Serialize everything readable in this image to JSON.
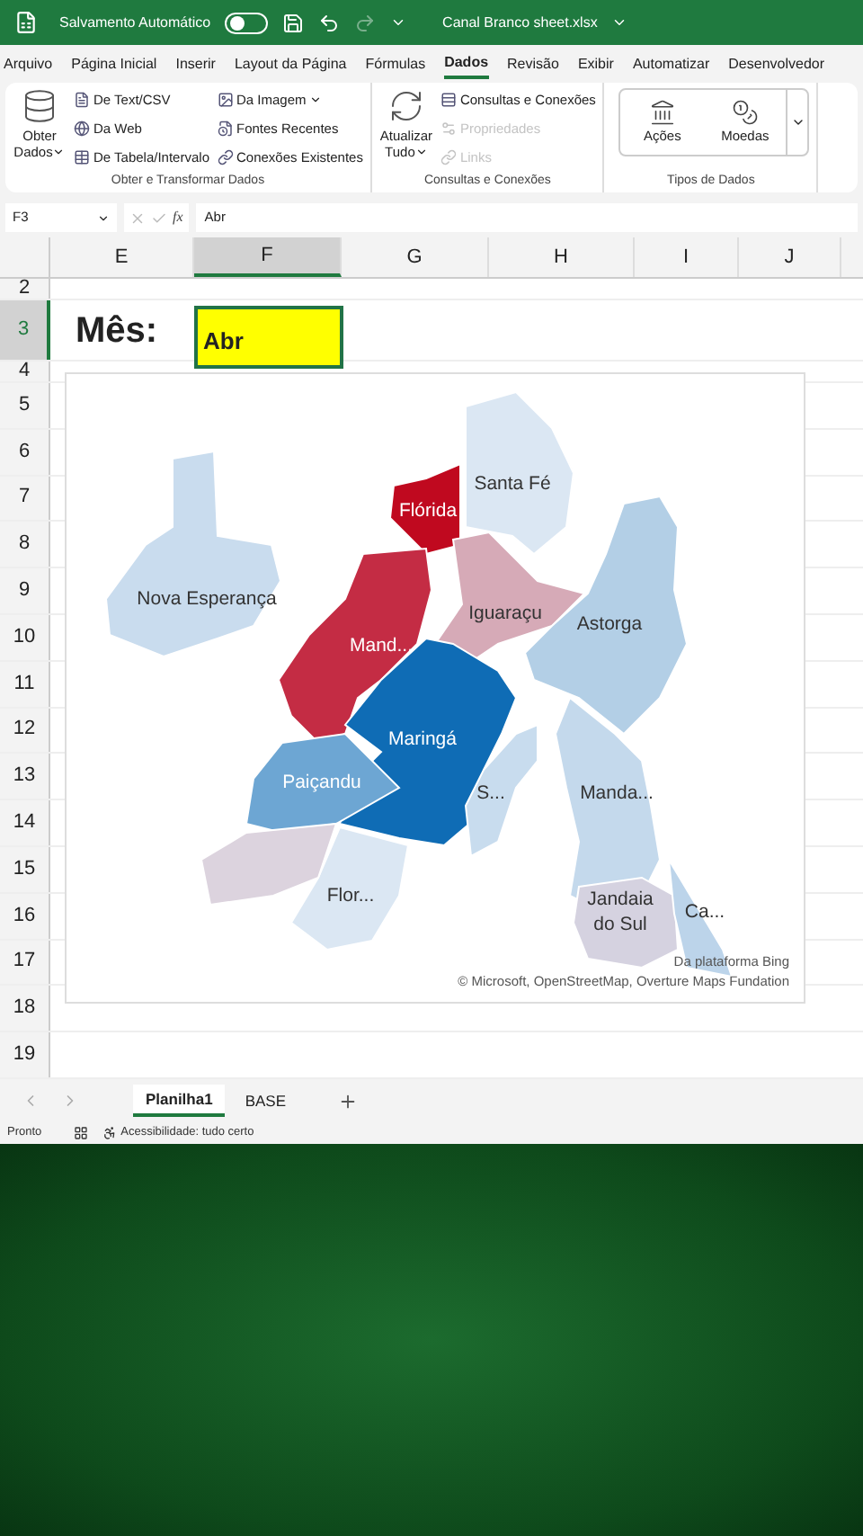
{
  "title_bar": {
    "autosave_label": "Salvamento Automático",
    "autosave_on": false,
    "filename": "Canal Branco sheet.xlsx"
  },
  "menu_tabs": [
    {
      "label": "Arquivo",
      "selected": false
    },
    {
      "label": "Página Inicial",
      "selected": false
    },
    {
      "label": "Inserir",
      "selected": false
    },
    {
      "label": "Layout da Página",
      "selected": false
    },
    {
      "label": "Fórmulas",
      "selected": false
    },
    {
      "label": "Dados",
      "selected": true
    },
    {
      "label": "Revisão",
      "selected": false
    },
    {
      "label": "Exibir",
      "selected": false
    },
    {
      "label": "Automatizar",
      "selected": false
    },
    {
      "label": "Desenvolvedor",
      "selected": false
    }
  ],
  "ribbon_groups": [
    {
      "title": "Obter e Transformar Dados",
      "large_buttons": [
        {
          "lines": [
            "Obter",
            "Dados"
          ],
          "dropdown": true
        }
      ],
      "columns": [
        [
          {
            "label": "De Text/CSV",
            "disabled": false,
            "dropdown": false
          },
          {
            "label": "Da Web",
            "disabled": false,
            "dropdown": false
          },
          {
            "label": "De Tabela/Intervalo",
            "disabled": false,
            "dropdown": false
          }
        ],
        [
          {
            "label": "Da Imagem",
            "disabled": false,
            "dropdown": true
          },
          {
            "label": "Fontes Recentes",
            "disabled": false,
            "dropdown": false
          },
          {
            "label": "Conexões Existentes",
            "disabled": false,
            "dropdown": false
          }
        ]
      ]
    },
    {
      "title": "Consultas e Conexões",
      "large_buttons": [
        {
          "lines": [
            "Atualizar",
            "Tudo"
          ],
          "dropdown": true
        }
      ],
      "columns": [
        [
          {
            "label": "Consultas e Conexões",
            "disabled": false,
            "dropdown": false
          },
          {
            "label": "Propriedades",
            "disabled": true,
            "dropdown": false
          },
          {
            "label": "Links",
            "disabled": true,
            "dropdown": false
          }
        ]
      ]
    },
    {
      "title": "Tipos de Dados",
      "data_types": [
        "Ações",
        "Moedas"
      ]
    }
  ],
  "formula_bar": {
    "name_box": "F3",
    "function_label": "fx",
    "value": "Abr"
  },
  "columns": [
    {
      "label": "E",
      "selected": false
    },
    {
      "label": "F",
      "selected": true
    },
    {
      "label": "G",
      "selected": false
    },
    {
      "label": "H",
      "selected": false
    },
    {
      "label": "I",
      "selected": false
    },
    {
      "label": "J",
      "selected": false
    }
  ],
  "rows": [
    {
      "label": "2",
      "selected": false
    },
    {
      "label": "3",
      "selected": true
    },
    {
      "label": "4",
      "selected": false
    },
    {
      "label": "5",
      "selected": false
    },
    {
      "label": "6",
      "selected": false
    },
    {
      "label": "7",
      "selected": false
    },
    {
      "label": "8",
      "selected": false
    },
    {
      "label": "9",
      "selected": false
    },
    {
      "label": "10",
      "selected": false
    },
    {
      "label": "11",
      "selected": false
    },
    {
      "label": "12",
      "selected": false
    },
    {
      "label": "13",
      "selected": false
    },
    {
      "label": "14",
      "selected": false
    },
    {
      "label": "15",
      "selected": false
    },
    {
      "label": "16",
      "selected": false
    },
    {
      "label": "17",
      "selected": false
    },
    {
      "label": "18",
      "selected": false
    },
    {
      "label": "19",
      "selected": false
    }
  ],
  "cells": {
    "label": "Mês:",
    "value": "Abr"
  },
  "map_chart": {
    "regions": [
      {
        "name": "Nova Esperança",
        "color": "#c9dcee"
      },
      {
        "name": "Santa Fé",
        "color": "#dbe7f3"
      },
      {
        "name": "Flórida",
        "color": "#c0091f"
      },
      {
        "name": "Mand...",
        "color": "#c42c44"
      },
      {
        "name": "Iguaraçu",
        "color": "#d6aab7"
      },
      {
        "name": "Astorga",
        "color": "#b3cfe6"
      },
      {
        "name": "Maringá",
        "color": "#0f6cb5"
      },
      {
        "name": "Paiçandu",
        "color": "#6da6d3"
      },
      {
        "name": "S...",
        "color": "#c8dcee"
      },
      {
        "name": "Manda...",
        "color": "#c4d9ec"
      },
      {
        "name": "Jandaia do Sul",
        "color": "#d5d2e0"
      },
      {
        "name": "Ca...",
        "color": "#bcd4ea"
      },
      {
        "name": "Flor...",
        "color": "#dbe7f3"
      },
      {
        "color": "#dcd3de"
      }
    ],
    "source": "Da plataforma Bing",
    "attribution": "© Microsoft, OpenStreetMap, Overture Maps Fundation"
  },
  "sheet_tabs": [
    {
      "label": "Planilha1",
      "selected": true
    },
    {
      "label": "BASE",
      "selected": false
    }
  ],
  "status_bar": {
    "mode": "Pronto",
    "accessibility": "Acessibilidade: tudo certo"
  }
}
